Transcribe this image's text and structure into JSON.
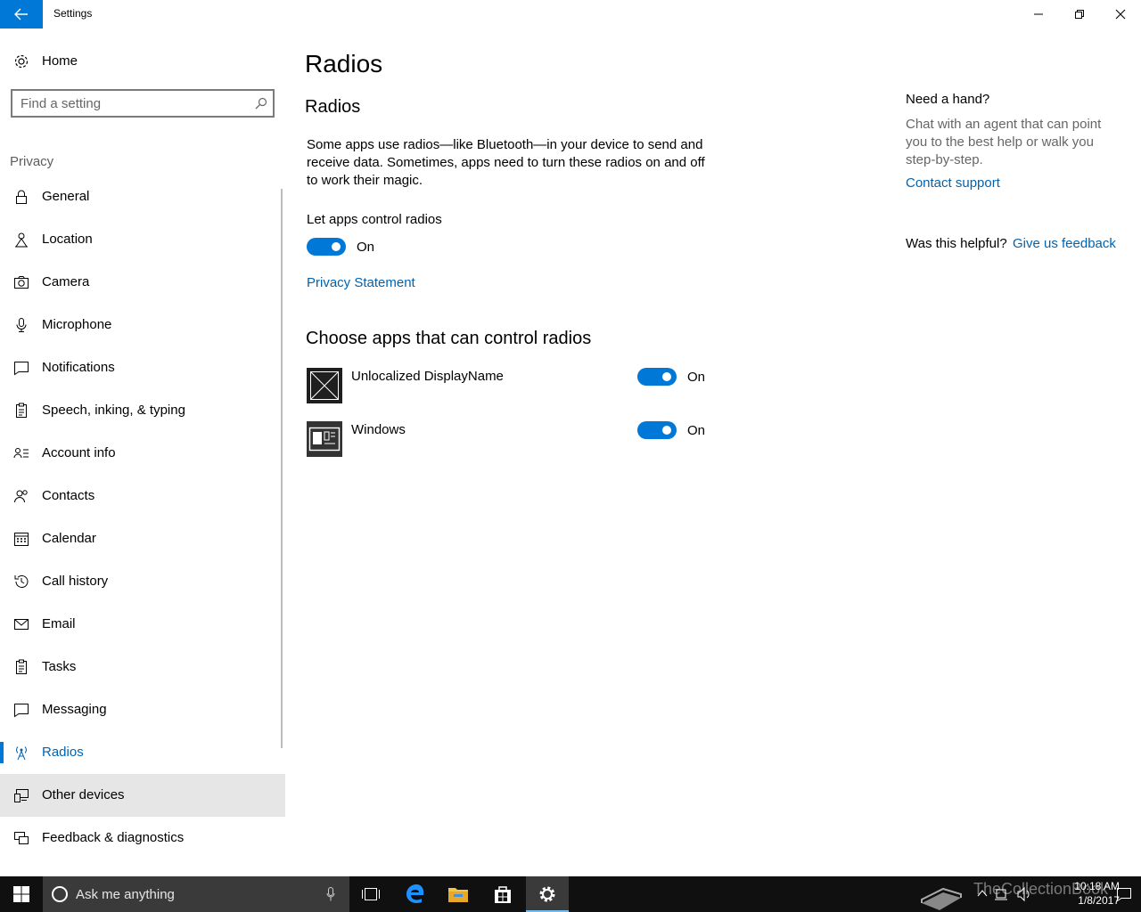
{
  "window": {
    "title": "Settings"
  },
  "sidebar": {
    "home_label": "Home",
    "search_placeholder": "Find a setting",
    "section_label": "Privacy",
    "items": [
      {
        "label": "General",
        "icon": "lock-icon"
      },
      {
        "label": "Location",
        "icon": "location-icon"
      },
      {
        "label": "Camera",
        "icon": "camera-icon"
      },
      {
        "label": "Microphone",
        "icon": "microphone-icon"
      },
      {
        "label": "Notifications",
        "icon": "notifications-icon"
      },
      {
        "label": "Speech, inking, & typing",
        "icon": "speech-icon"
      },
      {
        "label": "Account info",
        "icon": "account-info-icon"
      },
      {
        "label": "Contacts",
        "icon": "contacts-icon"
      },
      {
        "label": "Calendar",
        "icon": "calendar-icon"
      },
      {
        "label": "Call history",
        "icon": "history-icon"
      },
      {
        "label": "Email",
        "icon": "email-icon"
      },
      {
        "label": "Tasks",
        "icon": "tasks-icon"
      },
      {
        "label": "Messaging",
        "icon": "messaging-icon"
      },
      {
        "label": "Radios",
        "icon": "radios-icon",
        "active": true
      },
      {
        "label": "Other devices",
        "icon": "devices-icon",
        "hover": true
      },
      {
        "label": "Feedback & diagnostics",
        "icon": "feedback-icon"
      }
    ]
  },
  "main": {
    "page_title": "Radios",
    "sub_title": "Radios",
    "description": "Some apps use radios—like Bluetooth—in your device to send and receive data. Sometimes, apps need to turn these radios on and off to work their magic.",
    "control_label": "Let apps control radios",
    "control_state": "On",
    "privacy_link": "Privacy Statement",
    "choose_title": "Choose apps that can control radios",
    "apps": [
      {
        "name": "Unlocalized DisplayName",
        "state": "On"
      },
      {
        "name": "Windows",
        "state": "On"
      }
    ]
  },
  "help": {
    "title": "Need a hand?",
    "text": "Chat with an agent that can point you to the best help or walk you step-by-step.",
    "contact_link": "Contact support",
    "helpful_label": "Was this helpful?",
    "feedback_link": "Give us feedback"
  },
  "taskbar": {
    "search_text": "Ask me anything",
    "time": "10:18 AM",
    "date": "1/8/2017",
    "watermark": "TheCollectionBook"
  },
  "colors": {
    "accent": "#0078d7",
    "link": "#0063b1",
    "taskbar": "#101010"
  }
}
